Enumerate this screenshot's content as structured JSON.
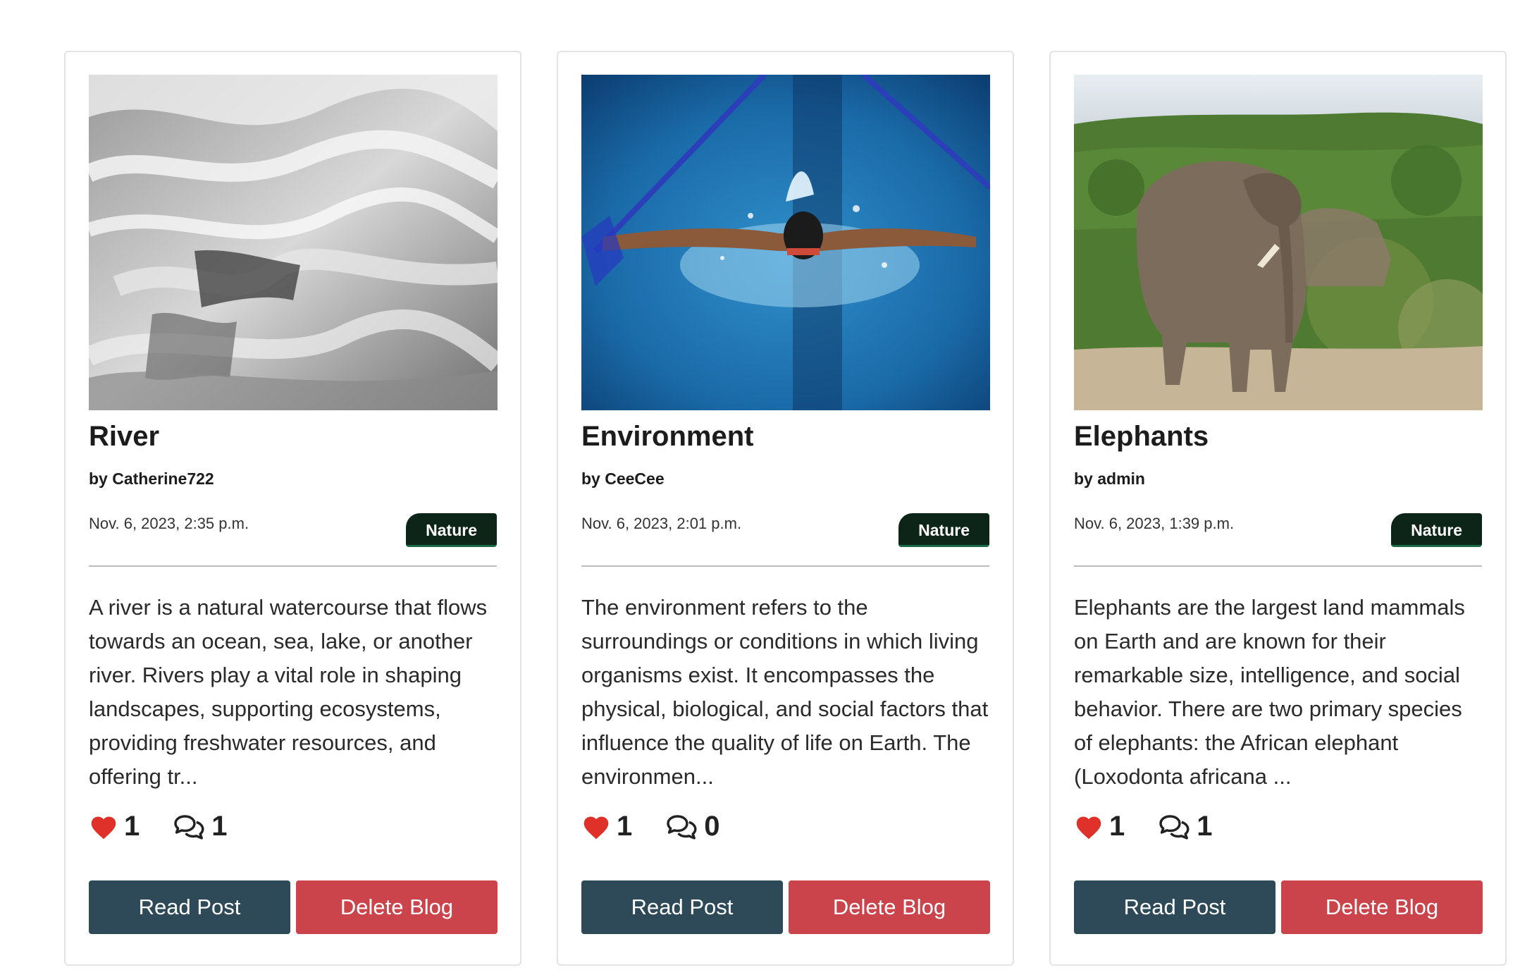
{
  "posts": [
    {
      "title": "River",
      "author": "by Catherine722",
      "date": "Nov. 6, 2023, 2:35 p.m.",
      "category": "Nature",
      "excerpt": "A river is a natural watercourse that flows towards an ocean, sea, lake, or another river. Rivers play a vital role in shaping landscapes, supporting ecosystems, providing freshwater resources, and offering tr...",
      "likes": "1",
      "comments": "1",
      "read_label": "Read Post",
      "delete_label": "Delete Blog",
      "image": "river-photo"
    },
    {
      "title": "Environment",
      "author": "by CeeCee",
      "date": "Nov. 6, 2023, 2:01 p.m.",
      "category": "Nature",
      "excerpt": "The environment refers to the surroundings or conditions in which living organisms exist. It encompasses the physical, biological, and social factors that influence the quality of life on Earth. The environmen...",
      "likes": "1",
      "comments": "0",
      "read_label": "Read Post",
      "delete_label": "Delete Blog",
      "image": "swimmer-photo"
    },
    {
      "title": "Elephants",
      "author": "by admin",
      "date": "Nov. 6, 2023, 1:39 p.m.",
      "category": "Nature",
      "excerpt": "Elephants are the largest land mammals on Earth and are known for their remarkable size, intelligence, and social behavior. There are two primary species of elephants: the African elephant (Loxodonta africana ...",
      "likes": "1",
      "comments": "1",
      "read_label": "Read Post",
      "delete_label": "Delete Blog",
      "image": "elephants-photo"
    }
  ],
  "colors": {
    "read_button": "#2e4a58",
    "delete_button": "#cc444b",
    "badge": "#0c2518",
    "heart": "#e0302a"
  },
  "icons": {
    "like": "heart-icon",
    "comment": "comments-icon"
  }
}
